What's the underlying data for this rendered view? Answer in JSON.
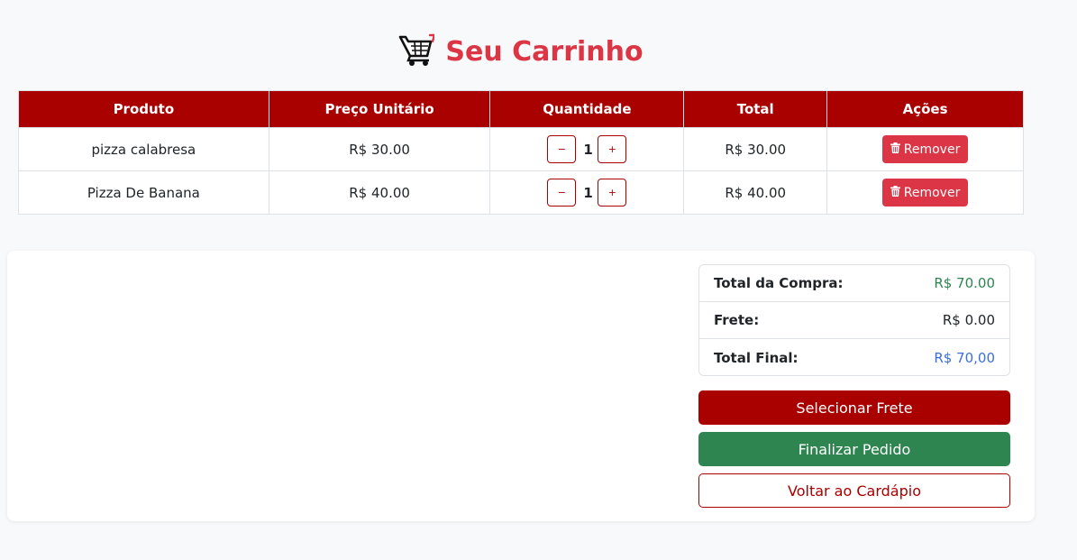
{
  "header": {
    "title": "Seu Carrinho",
    "icon": "shopping-cart-icon"
  },
  "table": {
    "columns": [
      "Produto",
      "Preço Unitário",
      "Quantidade",
      "Total",
      "Ações"
    ],
    "rows": [
      {
        "product": "pizza calabresa",
        "unit_price": "R$ 30.00",
        "quantity": "1",
        "total": "R$ 30.00",
        "remove_label": "Remover"
      },
      {
        "product": "Pizza De Banana",
        "unit_price": "R$ 40.00",
        "quantity": "1",
        "total": "R$ 40.00",
        "remove_label": "Remover"
      }
    ],
    "minus_label": "−",
    "plus_label": "+"
  },
  "summary": {
    "subtotal_label": "Total da Compra:",
    "subtotal_value": "R$ 70.00",
    "shipping_label": "Frete:",
    "shipping_value": "R$ 0.00",
    "final_label": "Total Final:",
    "final_value": "R$ 70,00"
  },
  "actions": {
    "select_shipping": "Selecionar Frete",
    "finish_order": "Finalizar Pedido",
    "back_to_menu": "Voltar ao Cardápio"
  },
  "colors": {
    "brand": "#a90000",
    "title": "#dc3545",
    "remove": "#dc3545",
    "success": "#2e8550",
    "subtotal": "#2e8550",
    "final": "#3c6fdc"
  }
}
